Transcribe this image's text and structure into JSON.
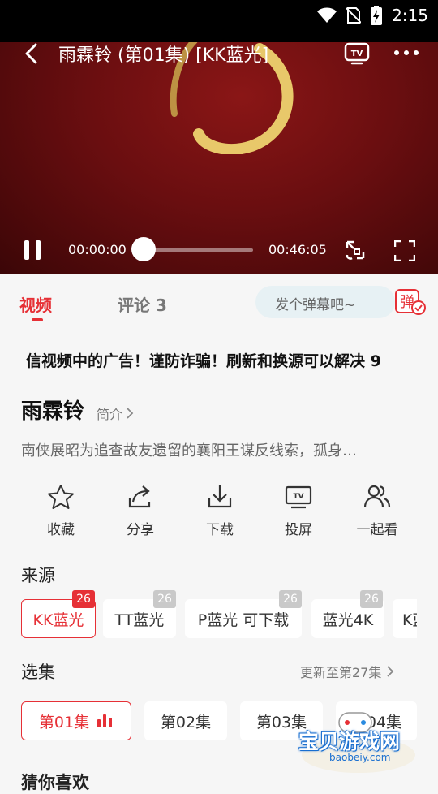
{
  "status": {
    "time": "2:15"
  },
  "player": {
    "title": "雨霖铃 (第01集) [KK蓝光]",
    "current_time": "00:00:00",
    "duration": "00:46:05",
    "progress": 0.0
  },
  "tabs": {
    "video": "视频",
    "comment": "评论 3"
  },
  "danmu": {
    "placeholder": "发个弹幕吧~",
    "button_char": "弹"
  },
  "notice": "信视频中的广告！谨防诈骗！刷新和换源可以解决 9",
  "show": {
    "name": "雨霖铃",
    "intro_label": "简介",
    "description": "南侠展昭为追查故友遗留的襄阳王谋反线索，孤身…"
  },
  "actions": [
    {
      "label": "收藏",
      "icon": "star-icon"
    },
    {
      "label": "分享",
      "icon": "share-icon"
    },
    {
      "label": "下载",
      "icon": "download-icon"
    },
    {
      "label": "投屏",
      "icon": "tv-cast-icon"
    },
    {
      "label": "一起看",
      "icon": "users-icon"
    }
  ],
  "sources": {
    "label": "来源",
    "items": [
      {
        "name": "KK蓝光",
        "count": "26",
        "active": true
      },
      {
        "name": "TT蓝光",
        "count": "26",
        "active": false
      },
      {
        "name": "P蓝光 可下载",
        "count": "26",
        "active": false
      },
      {
        "name": "蓝光4K",
        "count": "26",
        "active": false
      },
      {
        "name": "K蓝",
        "count": "",
        "active": false
      }
    ]
  },
  "episodes": {
    "label": "选集",
    "update_text": "更新至第27集",
    "items": [
      {
        "name": "第01集",
        "active": true
      },
      {
        "name": "第02集",
        "active": false
      },
      {
        "name": "第03集",
        "active": false
      },
      {
        "name": "第04集",
        "active": false
      }
    ]
  },
  "bottom_section": "猜你喜欢",
  "watermark": {
    "text": "宝贝游戏网",
    "url": "baobeiy.com"
  },
  "colors": {
    "accent": "#e63036",
    "video_bg": "#6a0e10",
    "ring_gold": "#e8c86a"
  }
}
